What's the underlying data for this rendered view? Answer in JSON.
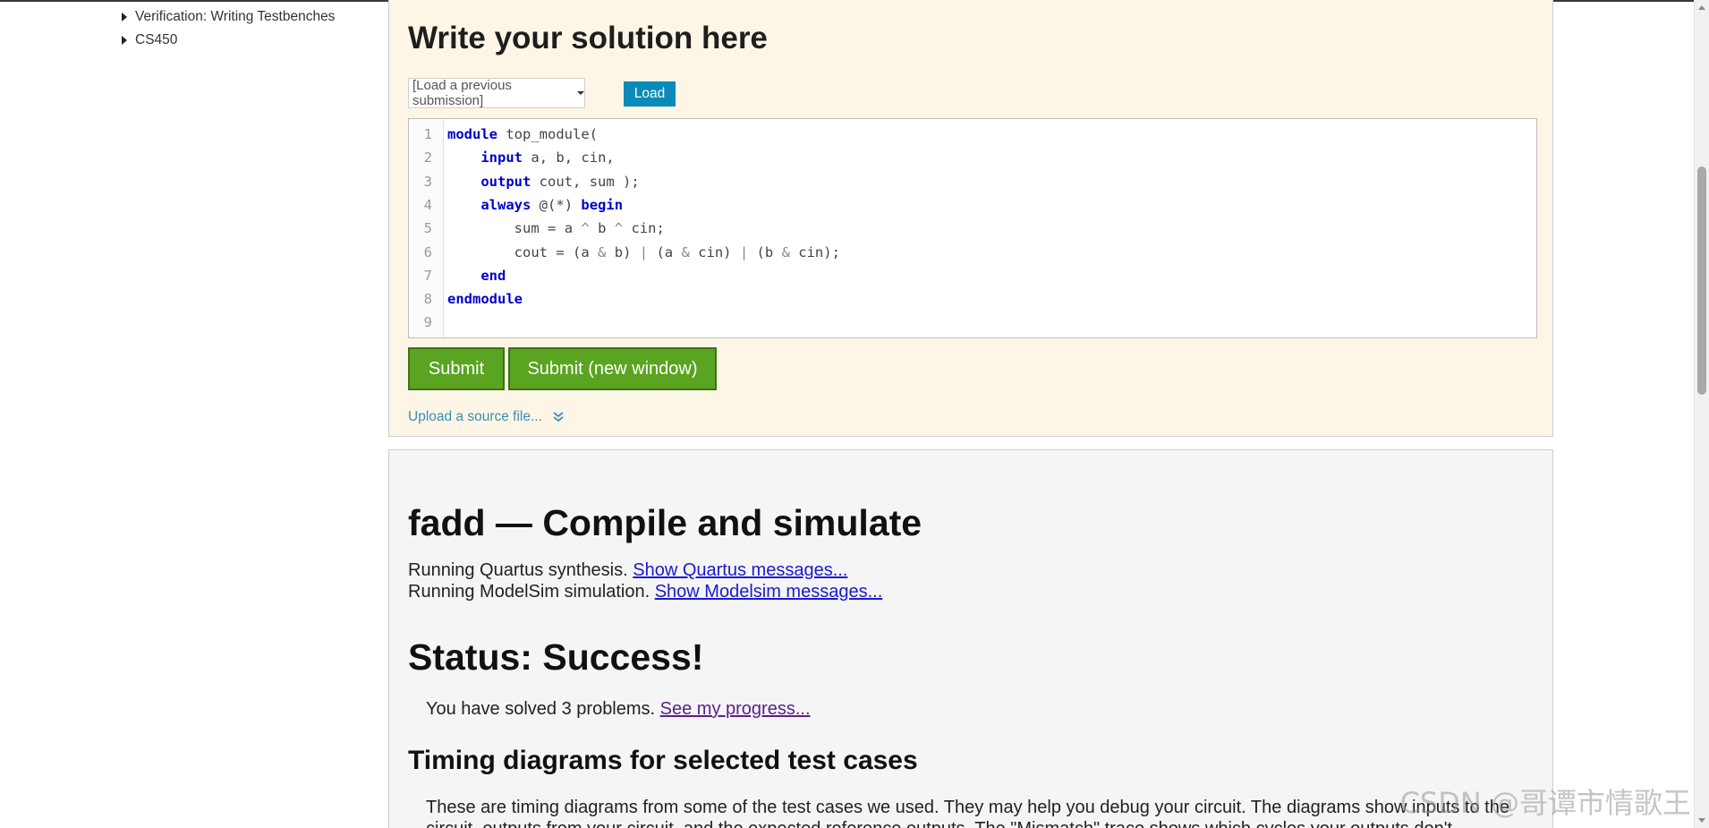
{
  "nav": {
    "items": [
      {
        "label": "Verification: Writing Testbenches"
      },
      {
        "label": "CS450"
      }
    ]
  },
  "solution": {
    "title": "Write your solution here",
    "load_select_value": "[Load a previous submission]",
    "load_button": "Load",
    "submit_label": "Submit",
    "submit_new_window_label": "Submit (new window)",
    "upload_label": "Upload a source file...",
    "code_lines": [
      "module top_module(",
      "    input a, b, cin,",
      "    output cout, sum );",
      "    always @(*) begin",
      "        sum = a ^ b ^ cin;",
      "        cout = (a & b) | (a & cin) | (b & cin);",
      "    end",
      "endmodule",
      ""
    ],
    "keywords": [
      "module",
      "input",
      "output",
      "always",
      "begin",
      "end",
      "endmodule"
    ]
  },
  "result": {
    "title": "fadd — Compile and simulate",
    "quartus_text": "Running Quartus synthesis.",
    "quartus_link": "Show Quartus messages...",
    "modelsim_text": "Running ModelSim simulation.",
    "modelsim_link": "Show Modelsim messages...",
    "status": "Status: Success!",
    "progress_text": "You have solved 3 problems.",
    "progress_link": "See my progress...",
    "timing_title": "Timing diagrams for selected test cases",
    "timing_para": "These are timing diagrams from some of the test cases we used. They may help you debug your circuit. The diagrams show inputs to the circuit, outputs from your circuit, and the expected reference outputs. The \"Mismatch\" trace shows which cycles your outputs don't"
  },
  "watermark": "CSDN @哥谭市情歌王",
  "colors": {
    "solution_bg": "#fdf6e6",
    "result_bg": "#f5f5f5",
    "load_button": "#0b8ab8",
    "submit_button": "#5aa421",
    "keyword": "#0000cc",
    "link": "#1a1ad0"
  }
}
